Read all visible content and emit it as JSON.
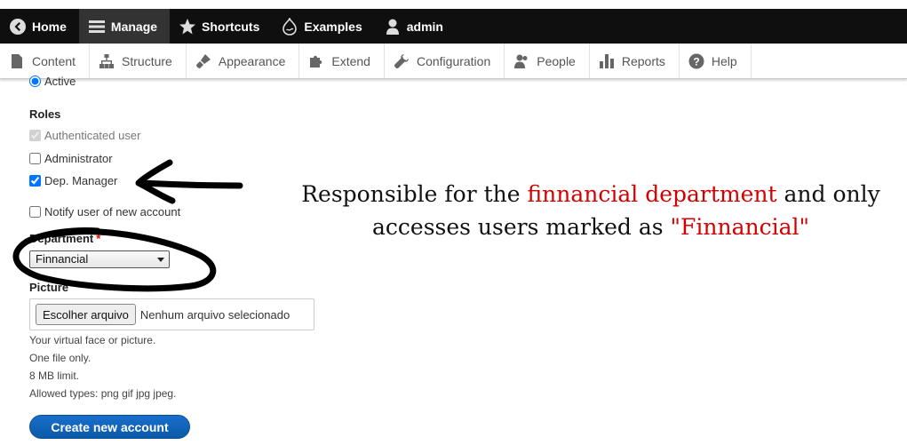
{
  "toolbar": {
    "items": [
      {
        "label": "Home",
        "icon": "drupal-back-icon"
      },
      {
        "label": "Manage",
        "icon": "hamburger-icon"
      },
      {
        "label": "Shortcuts",
        "icon": "star-icon"
      },
      {
        "label": "Examples",
        "icon": "drupal-drop-icon"
      },
      {
        "label": "admin",
        "icon": "user-icon"
      }
    ]
  },
  "tray": {
    "items": [
      {
        "label": "Content",
        "icon": "page-icon"
      },
      {
        "label": "Structure",
        "icon": "sitemap-icon"
      },
      {
        "label": "Appearance",
        "icon": "paint-icon"
      },
      {
        "label": "Extend",
        "icon": "puzzle-icon"
      },
      {
        "label": "Configuration",
        "icon": "wrench-icon"
      },
      {
        "label": "People",
        "icon": "people-icon"
      },
      {
        "label": "Reports",
        "icon": "bar-chart-icon"
      },
      {
        "label": "Help",
        "icon": "help-icon"
      }
    ]
  },
  "form": {
    "status_active_label": "Active",
    "roles_label": "Roles",
    "roles": [
      {
        "label": "Authenticated user",
        "checked": true,
        "disabled": true
      },
      {
        "label": "Administrator",
        "checked": false,
        "disabled": false
      },
      {
        "label": "Dep. Manager",
        "checked": true,
        "disabled": false
      }
    ],
    "notify_label": "Notify user of new account",
    "department_label": "Department",
    "department_required": "*",
    "department_value": "Finnancial",
    "picture_label": "Picture",
    "file_button": "Escolher arquivo",
    "file_status": "Nenhum arquivo selecionado",
    "help_lines": [
      "Your virtual face or picture.",
      "One file only.",
      "8 MB limit.",
      "Allowed types: png gif jpg jpeg."
    ],
    "submit_label": "Create new account"
  },
  "annotation": {
    "line1_a": "Responsible for the ",
    "line1_red": "finnancial department",
    "line1_b": " and only",
    "line2_a": "accesses users marked as ",
    "line2_red": "\"Finnancial\"",
    "red_color": "#d40000"
  },
  "colors": {
    "toolbar_bg": "#0f0f0f",
    "active_tab": "#333333",
    "primary_button": "#0b5aa8"
  }
}
